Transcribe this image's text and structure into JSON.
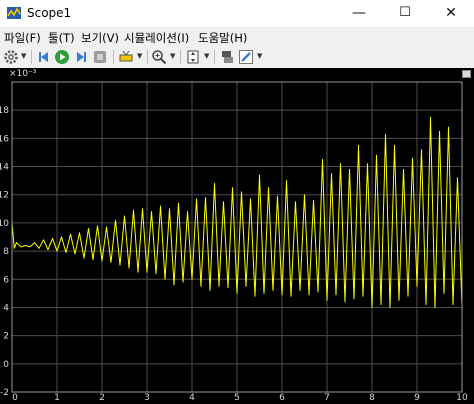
{
  "window": {
    "title": "Scope1",
    "minimize": "—",
    "maximize": "☐",
    "close": "✕"
  },
  "menu": {
    "items": [
      "파일(F)",
      "툴(T)",
      "보기(V)",
      "시뮬레이션(I)",
      "도움말(H)"
    ]
  },
  "toolbar": {
    "icons": [
      "gear-icon",
      "step-back-icon",
      "run-icon",
      "step-forward-icon",
      "stop-icon",
      "highlight-icon",
      "zoom-icon",
      "autoscale-icon",
      "cursor-measure-icon",
      "edit-icon"
    ]
  },
  "colors": {
    "background": "#000000",
    "grid": "#4d4d4d",
    "signal": "#ffff00",
    "axis_text": "#d8d8d8"
  },
  "chart_data": {
    "type": "line",
    "y_exponent": "×10⁻³",
    "xlim": [
      0,
      10
    ],
    "ylim": [
      -2,
      20
    ],
    "xticks": [
      0,
      1,
      2,
      3,
      4,
      5,
      6,
      7,
      8,
      9,
      10
    ],
    "yticks": [
      -2,
      0,
      2,
      4,
      6,
      8,
      10,
      12,
      14,
      16,
      18
    ],
    "grid": true,
    "series": [
      {
        "color": "#ffff00",
        "x": [
          0,
          0.05,
          0.1,
          0.2,
          0.3,
          0.4,
          0.5,
          0.6,
          0.7,
          0.8,
          0.9,
          1.0,
          1.1,
          1.2,
          1.3,
          1.4,
          1.5,
          1.6,
          1.7,
          1.8,
          1.9,
          2.0,
          2.1,
          2.2,
          2.3,
          2.4,
          2.5,
          2.6,
          2.7,
          2.8,
          2.9,
          3.0,
          3.1,
          3.2,
          3.3,
          3.4,
          3.5,
          3.6,
          3.7,
          3.8,
          3.9,
          4.0,
          4.1,
          4.2,
          4.3,
          4.4,
          4.5,
          4.6,
          4.7,
          4.8,
          4.9,
          5.0,
          5.1,
          5.2,
          5.3,
          5.4,
          5.5,
          5.6,
          5.7,
          5.8,
          5.9,
          6.0,
          6.1,
          6.2,
          6.3,
          6.4,
          6.5,
          6.6,
          6.7,
          6.8,
          6.9,
          7.0,
          7.1,
          7.2,
          7.3,
          7.4,
          7.5,
          7.6,
          7.7,
          7.8,
          7.9,
          8.0,
          8.1,
          8.2,
          8.3,
          8.4,
          8.5,
          8.6,
          8.7,
          8.8,
          8.9,
          9.0,
          9.1,
          9.2,
          9.3,
          9.4,
          9.5,
          9.6,
          9.7,
          9.8,
          9.9,
          10.0
        ],
        "y": [
          10.0,
          8.2,
          8.6,
          8.3,
          8.4,
          8.3,
          8.6,
          8.2,
          8.8,
          8.1,
          8.9,
          8.0,
          9.0,
          7.9,
          9.2,
          7.8,
          9.3,
          7.5,
          9.6,
          7.4,
          9.8,
          7.3,
          9.7,
          7.2,
          10.2,
          7.0,
          10.5,
          6.8,
          10.9,
          6.5,
          11.0,
          6.5,
          10.8,
          6.4,
          11.2,
          6.0,
          11.0,
          5.6,
          11.4,
          5.8,
          10.8,
          6.0,
          11.7,
          5.5,
          11.8,
          5.2,
          12.8,
          5.5,
          11.5,
          5.4,
          12.5,
          5.0,
          12.2,
          5.5,
          11.7,
          4.8,
          13.4,
          5.0,
          12.5,
          5.2,
          11.9,
          4.9,
          13.0,
          4.8,
          11.5,
          5.2,
          12.0,
          4.9,
          11.6,
          5.1,
          14.5,
          4.5,
          13.5,
          4.9,
          14.2,
          4.4,
          13.8,
          4.6,
          15.5,
          4.8,
          14.2,
          4.0,
          14.8,
          4.2,
          16.3,
          4.0,
          15.5,
          4.5,
          13.8,
          4.8,
          14.6,
          5.5,
          15.2,
          4.2,
          17.5,
          4.0,
          16.5,
          5.0,
          16.8,
          4.2,
          13.2,
          4.0
        ]
      }
    ]
  }
}
